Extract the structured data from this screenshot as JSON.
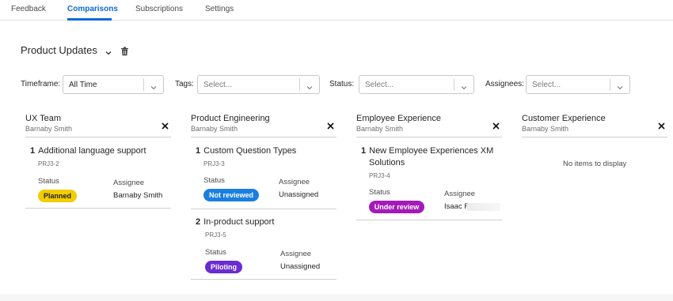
{
  "tabs": [
    {
      "label": "Feedback"
    },
    {
      "label": "Comparisons"
    },
    {
      "label": "Subscriptions"
    },
    {
      "label": "Settings"
    }
  ],
  "active_tab": "Comparisons",
  "page": {
    "title": "Product Updates"
  },
  "filters": {
    "timeframe": {
      "label": "Timeframe:",
      "value": "All Time"
    },
    "tags": {
      "label": "Tags:",
      "placeholder": "Select..."
    },
    "status": {
      "label": "Status:",
      "placeholder": "Select..."
    },
    "assignees": {
      "label": "Assignees:",
      "placeholder": "Select..."
    }
  },
  "columns": [
    {
      "title": "UX Team",
      "owner": "Barnaby Smith",
      "items": [
        {
          "num": "1",
          "title": "Additional language support",
          "key": "PRJ3-2",
          "status_label": "Status",
          "assignee_label": "Assignee",
          "status": "Planned",
          "assignee": "Barnaby Smith"
        }
      ]
    },
    {
      "title": "Product Engineering",
      "owner": "Barnaby Smith",
      "items": [
        {
          "num": "1",
          "title": "Custom Question Types",
          "key": "PRJ3-3",
          "status_label": "Status",
          "assignee_label": "Assignee",
          "status": "Not reviewed",
          "assignee": "Unassigned"
        },
        {
          "num": "2",
          "title": "In-product support",
          "key": "PRJ3-5",
          "status_label": "Status",
          "assignee_label": "Assignee",
          "status": "Piloting",
          "assignee": "Unassigned"
        }
      ]
    },
    {
      "title": "Employee Experience",
      "owner": "Barnaby Smith",
      "items": [
        {
          "num": "1",
          "title_line1": "New Employee Experiences XM",
          "title_line2": "Solutions",
          "key": "PRJ3-4",
          "status_label": "Status",
          "assignee_label": "Assignee",
          "status": "Under review",
          "assignee": "Isaac R"
        }
      ]
    },
    {
      "title": "Customer Experience",
      "owner": "Barnaby Smith",
      "empty_text": "No items to display"
    }
  ],
  "colors": {
    "accent": "#0b6bd3",
    "planned": "#f2cd00",
    "not_reviewed": "#1a7fe0",
    "piloting": "#6a2bd1",
    "under_review": "#a31ab8"
  }
}
